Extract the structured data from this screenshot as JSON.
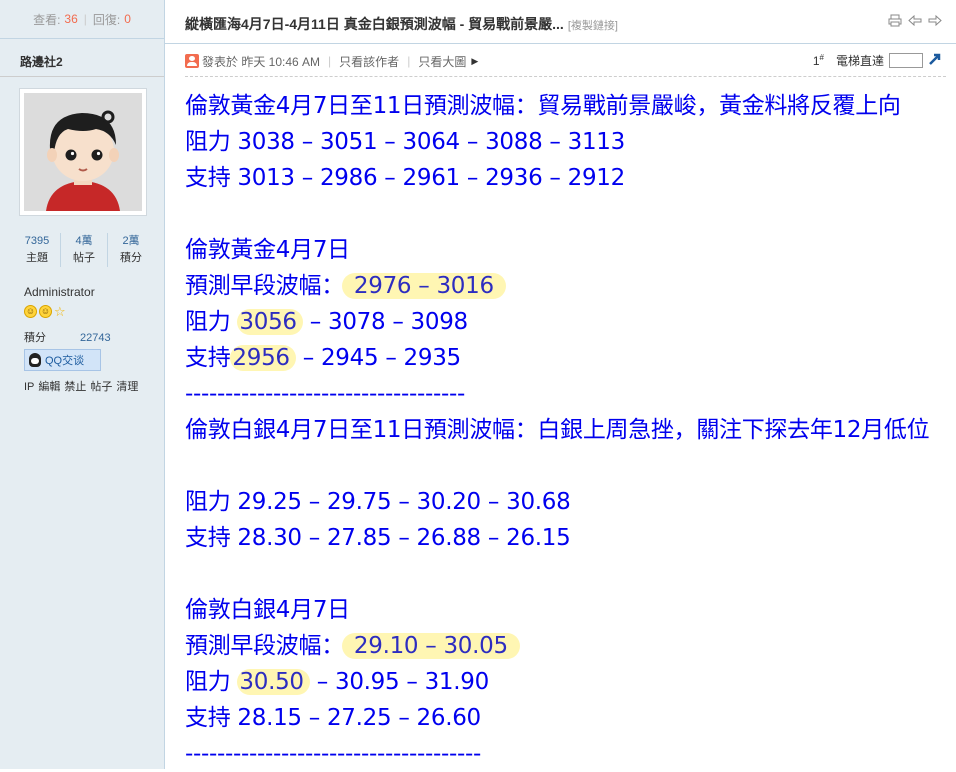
{
  "sidebar": {
    "views_label": "查看:",
    "views": "36",
    "replies_label": "回復:",
    "replies": "0",
    "author": "路邊社2",
    "stats": [
      {
        "value": "7395",
        "label": "主題"
      },
      {
        "value": "4萬",
        "label": "帖子"
      },
      {
        "value": "2萬",
        "label": "積分"
      }
    ],
    "role": "Administrator",
    "credits_label": "積分",
    "credits_value": "22743",
    "qq_label": "QQ交谈",
    "admin_links": [
      "IP",
      "編輯",
      "禁止",
      "帖子",
      "清理"
    ]
  },
  "header": {
    "title": "縱橫匯海4月7日-4月11日 真金白銀預測波幅 - 貿易戰前景嚴...",
    "copy_link": "[複製鏈接]",
    "icons": [
      "print-icon",
      "prev-thread-icon",
      "next-thread-icon"
    ]
  },
  "post_meta": {
    "posted": "發表於 昨天 10:46 AM",
    "only_author": "只看該作者",
    "large_image": "只看大圖",
    "floor": "1",
    "floor_sup": "#",
    "goto_label": "電梯直達"
  },
  "content": {
    "lines": [
      "倫敦黃金4月7日至11日預測波幅：貿易戰前景嚴峻，黃金料將反覆上向",
      "阻力 3038 – 3051 – 3064 – 3088 – 3113",
      "支持 3013 – 2986 – 2961 – 2936 – 2912",
      "",
      "倫敦黃金4月7日",
      "預測早段波幅：",
      "2976 – 3016",
      "阻力 ",
      "3056",
      " – 3078 – 3098",
      "支持",
      "2956",
      " – 2945 – 2935",
      "-----------------------------------",
      "倫敦白銀4月7日至11日預測波幅：白銀上周急挫，關注下探去年12月低位",
      "阻力 29.25 – 29.75 – 30.20 – 30.68",
      "支持 28.30 – 27.85 – 26.88 – 26.15",
      "",
      "倫敦白銀4月7日",
      "預測早段波幅：",
      "29.10 – 30.05",
      "阻力 ",
      "30.50",
      " – 30.95 – 31.90",
      "支持 28.15 – 27.25 – 26.60",
      "-------------------------------------"
    ]
  }
}
